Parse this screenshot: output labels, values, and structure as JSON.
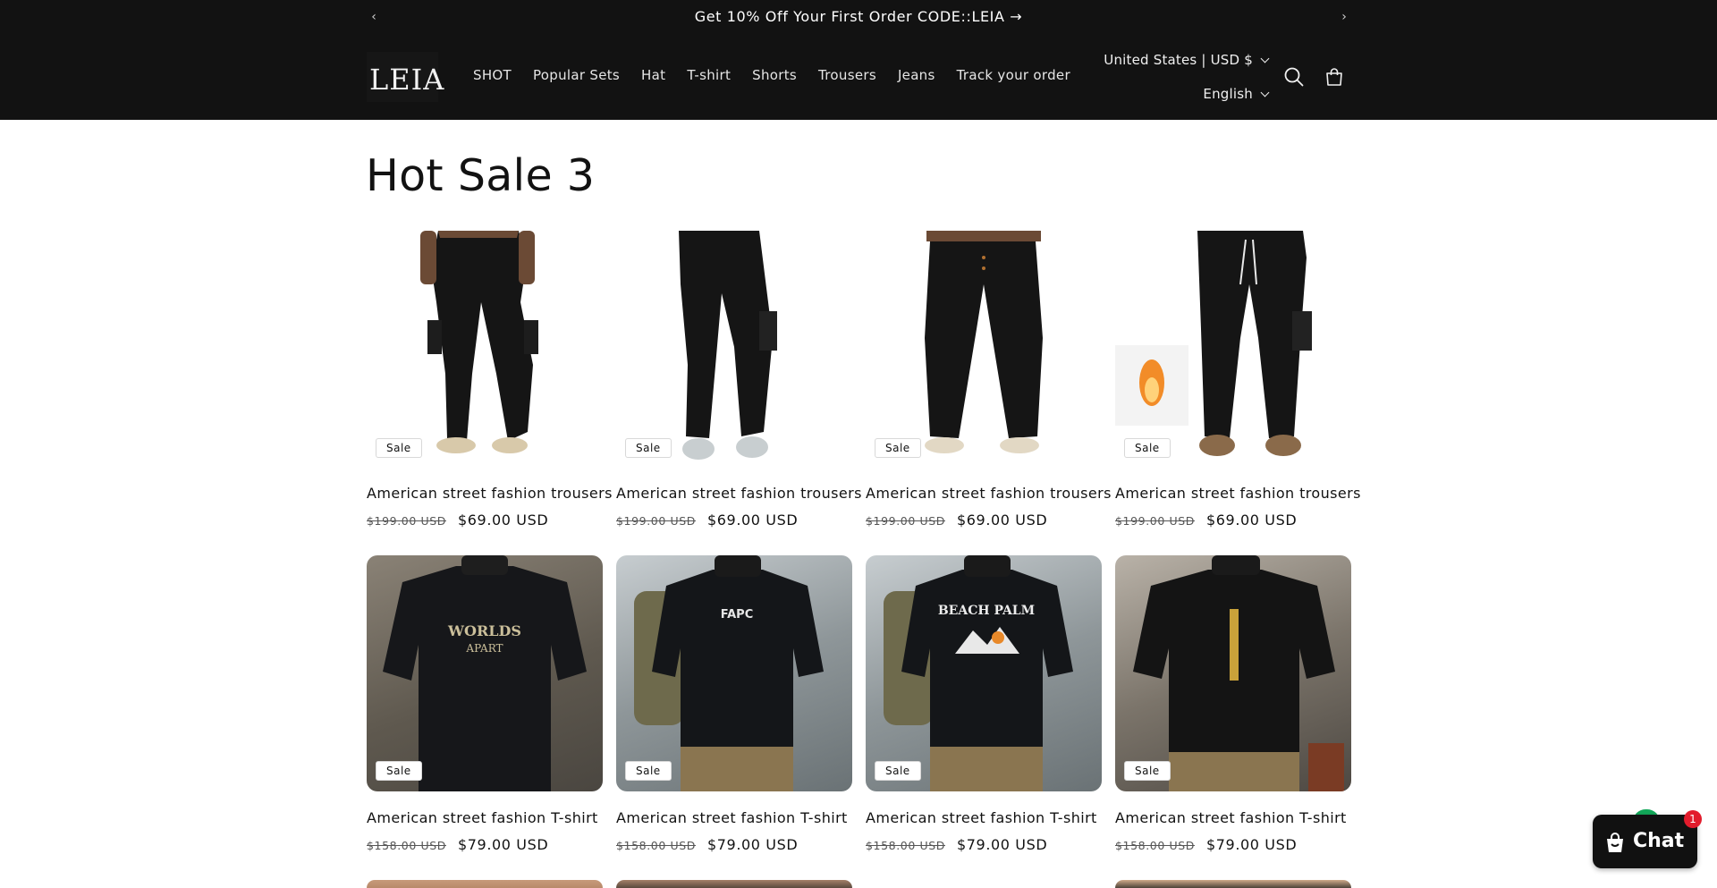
{
  "announcement": {
    "text": "Get 10% Off Your First Order CODE::LEIA →",
    "prev_icon": "chevron-left-icon",
    "next_icon": "chevron-right-icon"
  },
  "header": {
    "logo": "LEIA",
    "nav": [
      "SHOT",
      "Popular Sets",
      "Hat",
      "T-shirt",
      "Shorts",
      "Trousers",
      "Jeans",
      "Track your order"
    ],
    "country_selector": "United States | USD $",
    "language_selector": "English",
    "icons": [
      "search-icon",
      "cart-icon"
    ]
  },
  "main": {
    "title": "Hot Sale 3",
    "products": [
      {
        "title": "American street fashion trousers",
        "badge": "Sale",
        "old_price": "$199.00 USD",
        "price": "$69.00 USD"
      },
      {
        "title": "American street fashion trousers",
        "badge": "Sale",
        "old_price": "$199.00 USD",
        "price": "$69.00 USD"
      },
      {
        "title": "American street fashion trousers",
        "badge": "Sale",
        "old_price": "$199.00 USD",
        "price": "$69.00 USD"
      },
      {
        "title": "American street fashion trousers",
        "badge": "Sale",
        "old_price": "$199.00 USD",
        "price": "$69.00 USD"
      },
      {
        "title": "American street fashion T-shirt",
        "badge": "Sale",
        "old_price": "$158.00 USD",
        "price": "$79.00 USD"
      },
      {
        "title": "American street fashion T-shirt",
        "badge": "Sale",
        "old_price": "$158.00 USD",
        "price": "$79.00 USD"
      },
      {
        "title": "American street fashion T-shirt",
        "badge": "Sale",
        "old_price": "$158.00 USD",
        "price": "$79.00 USD"
      },
      {
        "title": "American street fashion T-shirt",
        "badge": "Sale",
        "old_price": "$158.00 USD",
        "price": "$79.00 USD"
      }
    ]
  },
  "chat": {
    "label": "Chat",
    "unread_count": "1",
    "accent": "#13a85a",
    "badge_color": "#e21c2c"
  },
  "colors": {
    "header_bg": "#121212",
    "page_bg": "#ffffff",
    "text": "#121212"
  }
}
